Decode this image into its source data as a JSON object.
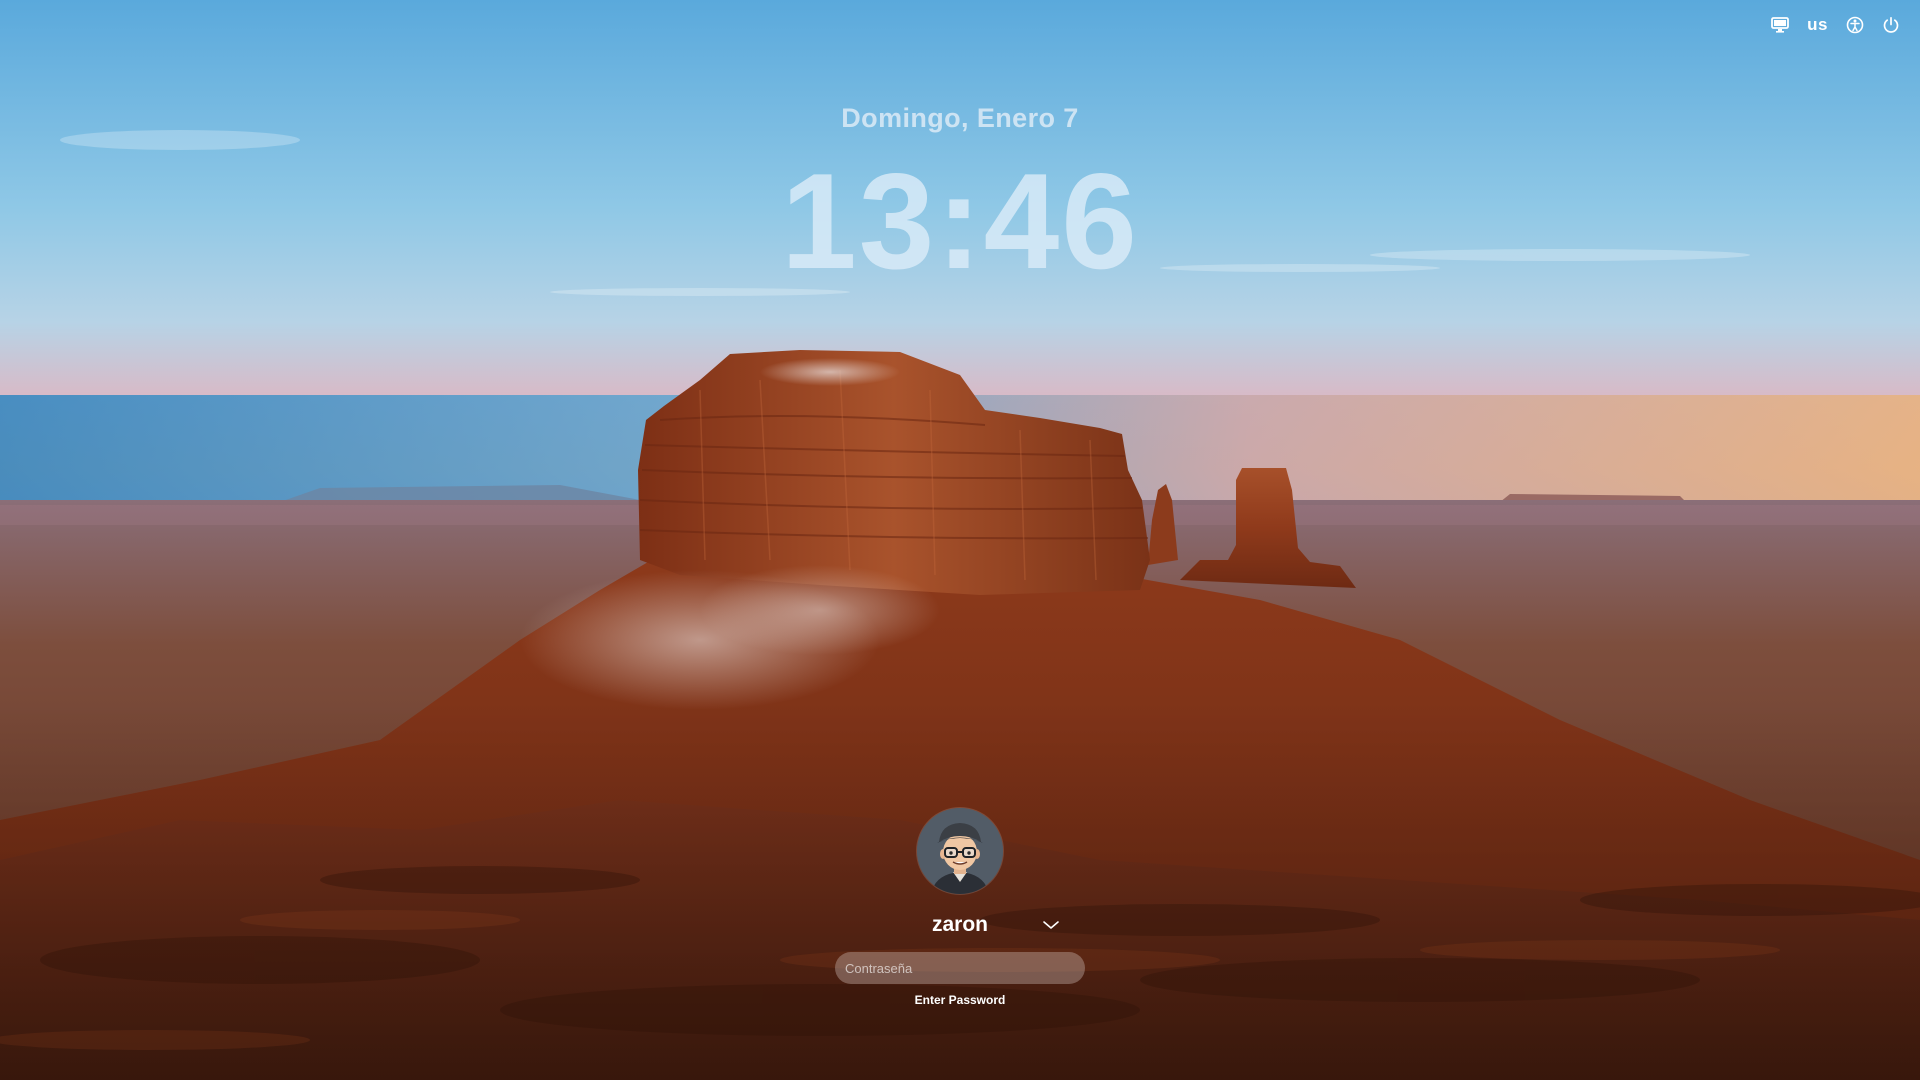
{
  "lock_screen": {
    "date": "Domingo, Enero 7",
    "time": "13:46"
  },
  "status_bar": {
    "display_icon": "monitor-icon",
    "keyboard_layout": "us",
    "accessibility_icon": "accessibility-icon",
    "power_icon": "power-icon"
  },
  "login": {
    "avatar_icon": "memoji-avatar",
    "username": "zaron",
    "user_switch_icon": "chevron-down-icon",
    "password_placeholder": "Contraseña",
    "password_value": "",
    "hint": "Enter Password"
  },
  "colors": {
    "sky_top": "#5fb1df",
    "sky_horizon": "#e8a7a4",
    "rock": "#9c3e1c",
    "ground": "#5a2614"
  }
}
